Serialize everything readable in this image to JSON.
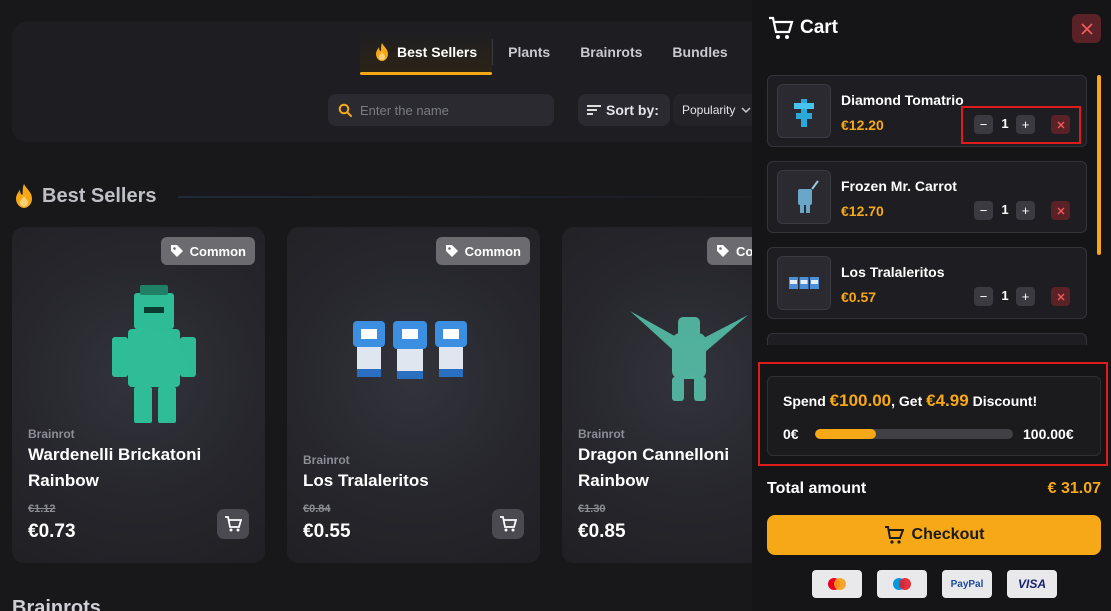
{
  "store": {
    "tabs": [
      {
        "label": "Best Sellers",
        "active": true,
        "icon": "flame-icon"
      },
      {
        "label": "Plants",
        "active": false
      },
      {
        "label": "Brainrots",
        "active": false
      },
      {
        "label": "Bundles",
        "active": false
      }
    ],
    "search": {
      "placeholder": "Enter the name",
      "value": ""
    },
    "sort": {
      "label": "Sort by:",
      "selected": "Popularity"
    },
    "section_title": "Best Sellers",
    "next_section_title": "Brainrots",
    "products": [
      {
        "rarity": "Common",
        "category": "Brainrot",
        "name": "Wardenelli Brickatoni Rainbow",
        "old_price": "€1.12",
        "price": "€0.73"
      },
      {
        "rarity": "Common",
        "category": "Brainrot",
        "name": "Los Tralaleritos",
        "old_price": "€0.84",
        "price": "€0.55"
      },
      {
        "rarity": "Common",
        "category": "Brainrot",
        "name": "Dragon Cannelloni Rainbow",
        "old_price": "€1.30",
        "price": "€0.85"
      }
    ]
  },
  "cart": {
    "title": "Cart",
    "items": [
      {
        "name": "Diamond Tomatrio",
        "price": "€12.20",
        "qty": "1"
      },
      {
        "name": "Frozen Mr. Carrot",
        "price": "€12.70",
        "qty": "1"
      },
      {
        "name": "Los Tralaleritos",
        "price": "€0.57",
        "qty": "1"
      }
    ],
    "promo": {
      "spend_prefix": "Spend",
      "spend_amount": "€100.00",
      "get_prefix": ", Get",
      "get_amount": "€4.99",
      "suffix": "Discount!",
      "min_label": "0€",
      "max_label": "100.00€",
      "progress": 0.31
    },
    "total_label": "Total amount",
    "total_value": "€ 31.07",
    "checkout_label": "Checkout",
    "payment_methods": [
      "mastercard-icon",
      "maestro-icon",
      "paypal-icon",
      "visa-icon"
    ],
    "payment_labels": {
      "paypal": "PayPal",
      "visa": "VISA"
    }
  },
  "colors": {
    "accent": "#f6a817",
    "danger": "#5a2126",
    "highlight": "#e01b1b"
  }
}
